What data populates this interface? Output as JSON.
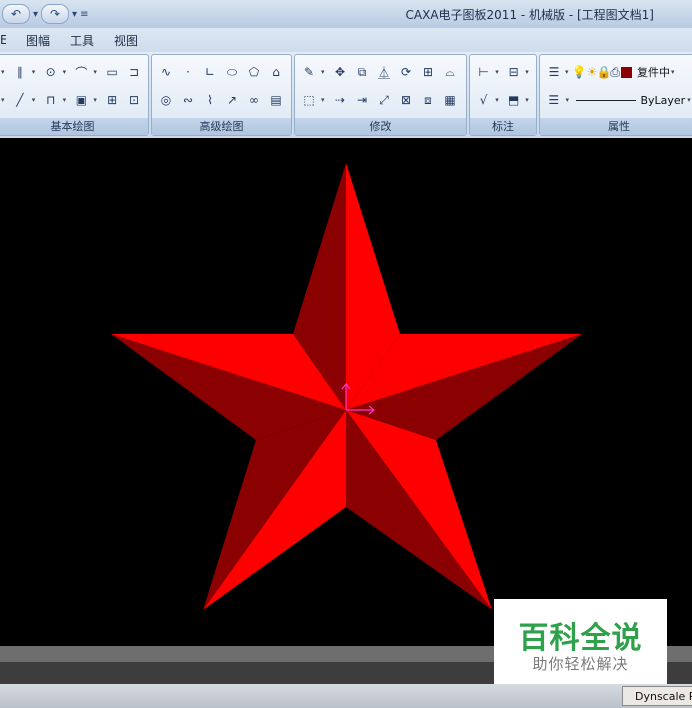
{
  "window": {
    "title": "CAXA电子图板2011 - 机械版 - [工程图文档1]"
  },
  "quick_access": {
    "undo_icon": "undo-arrow-icon",
    "redo_icon": "redo-arrow-icon",
    "customize_icon": "qat-customize-icon"
  },
  "menu": {
    "items": [
      {
        "label": "E"
      },
      {
        "label": "图幅"
      },
      {
        "label": "工具"
      },
      {
        "label": "视图"
      }
    ]
  },
  "ribbon": {
    "panels": [
      {
        "label": "基本绘图"
      },
      {
        "label": "高级绘图"
      },
      {
        "label": "修改"
      },
      {
        "label": "标注"
      },
      {
        "label": "属性"
      }
    ],
    "layer_label": "复件中",
    "linetype_label": "ByLayer",
    "layer_color": "#8b0000"
  },
  "canvas": {
    "background": "#000000",
    "star_bright": "#ff0000",
    "star_dark": "#8b0000",
    "ucs_color": "#ff33cc"
  },
  "status": {
    "dynscale": "Dynscale Rt"
  },
  "watermark": {
    "title": "百科全说",
    "subtitle": "助你轻松解决",
    "color": "#2ea14a"
  }
}
